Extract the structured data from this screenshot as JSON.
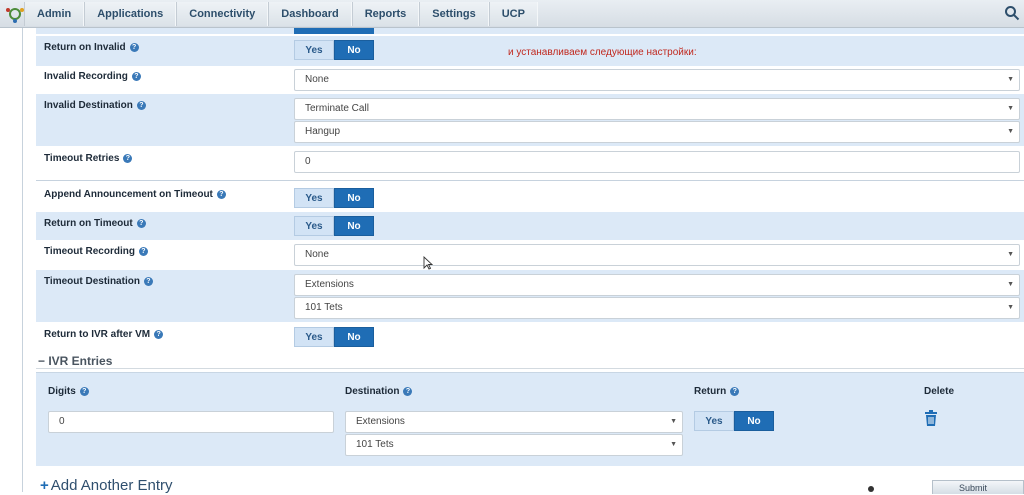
{
  "nav": {
    "tabs": [
      "Admin",
      "Applications",
      "Connectivity",
      "Dashboard",
      "Reports",
      "Settings",
      "UCP"
    ]
  },
  "toggle": {
    "yes": "Yes",
    "no": "No"
  },
  "note": "и устанавливаем следующие настройки:",
  "form": {
    "return_on_invalid": {
      "label": "Return on Invalid",
      "value": "No"
    },
    "invalid_recording": {
      "label": "Invalid Recording",
      "value": "None"
    },
    "invalid_destination": {
      "label": "Invalid Destination",
      "type": "Terminate Call",
      "target": "Hangup"
    },
    "timeout_retries": {
      "label": "Timeout Retries",
      "value": "0"
    },
    "append_announcement_timeout": {
      "label": "Append Announcement on Timeout",
      "value": "No"
    },
    "return_on_timeout": {
      "label": "Return on Timeout",
      "value": "No"
    },
    "timeout_recording": {
      "label": "Timeout Recording",
      "value": "None"
    },
    "timeout_destination": {
      "label": "Timeout Destination",
      "type": "Extensions",
      "target": "101 Tets"
    },
    "return_to_ivr_after_vm": {
      "label": "Return to IVR after VM",
      "value": "No"
    }
  },
  "ivr": {
    "section_title": "IVR Entries",
    "headers": {
      "digits": "Digits",
      "destination": "Destination",
      "return": "Return",
      "delete": "Delete"
    },
    "entries": [
      {
        "digits": "0",
        "destination_type": "Extensions",
        "destination_target": "101 Tets",
        "return": "No"
      }
    ],
    "add_label": "Add Another Entry"
  },
  "footer": {
    "submit": "Submit"
  },
  "colors": {
    "accent": "#1f6db5",
    "row_shade": "#dce9f7",
    "note": "#c0281e"
  },
  "icons": [
    "logo-icon",
    "search-icon",
    "help-icon",
    "chevron-down-icon",
    "trash-icon",
    "plus-icon",
    "cursor-icon"
  ]
}
